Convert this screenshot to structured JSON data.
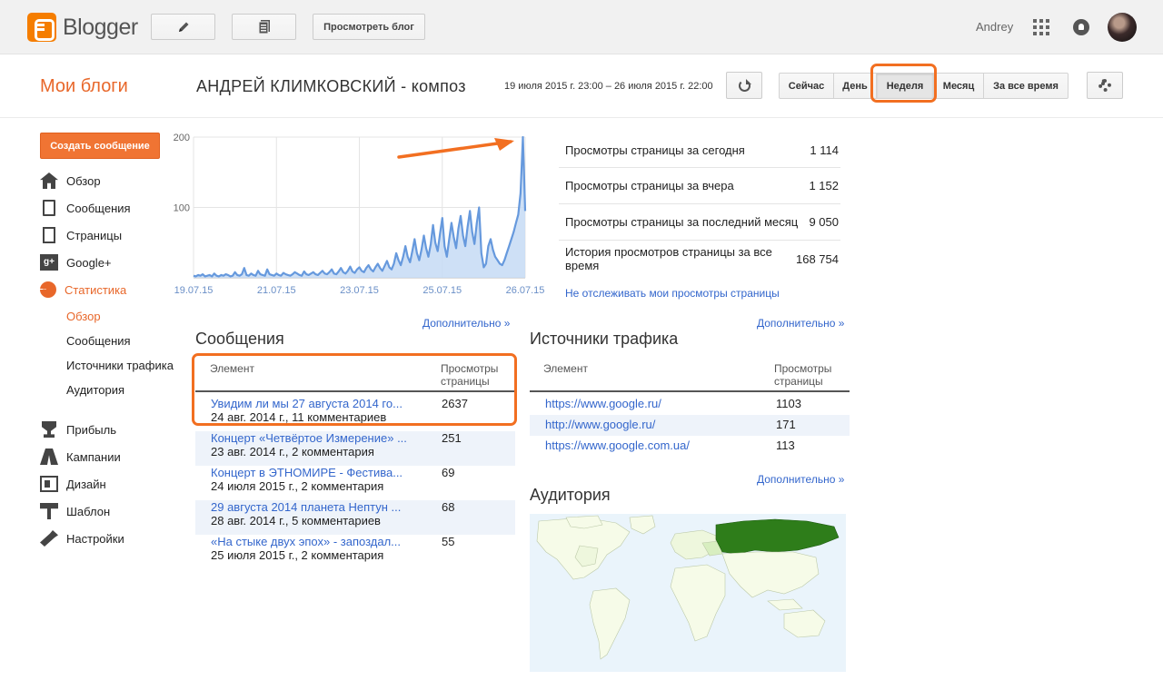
{
  "app": {
    "name": "Blogger"
  },
  "topbar": {
    "view_blog_label": "Просмотреть блог",
    "user_name": "Andrey"
  },
  "header": {
    "my_blogs": "Мои блоги",
    "blog_title": "АНДРЕЙ КЛИМКОВСКИЙ - композ",
    "date_range": "19 июля 2015 г. 23:00 – 26 июля 2015 г. 22:00",
    "periods": [
      "Сейчас",
      "День",
      "Неделя",
      "Месяц",
      "За все время"
    ],
    "active_period": "Неделя",
    "highlight_color": "#f26f21"
  },
  "sidebar": {
    "create_label": "Создать сообщение",
    "items": [
      {
        "label": "Обзор",
        "icon": "home-icon"
      },
      {
        "label": "Сообщения",
        "icon": "posts-icon"
      },
      {
        "label": "Страницы",
        "icon": "pages-icon"
      },
      {
        "label": "Google+",
        "icon": "google-plus-icon"
      },
      {
        "label": "Статистика",
        "icon": "stats-pie-icon"
      },
      {
        "label": "Прибыль",
        "icon": "trophy-icon"
      },
      {
        "label": "Кампании",
        "icon": "campaigns-icon"
      },
      {
        "label": "Дизайн",
        "icon": "layout-icon"
      },
      {
        "label": "Шаблон",
        "icon": "template-brush-icon"
      },
      {
        "label": "Настройки",
        "icon": "wrench-icon"
      }
    ],
    "stats_sub": [
      "Обзор",
      "Сообщения",
      "Источники трафика",
      "Аудитория"
    ],
    "accent": "#e8672a"
  },
  "chart_data": {
    "type": "area",
    "x_tick_labels": [
      "19.07.15",
      "21.07.15",
      "23.07.15",
      "25.07.15",
      "26.07.15"
    ],
    "y_tick_labels": [
      "200",
      "100"
    ],
    "ylim": [
      0,
      200
    ],
    "values": [
      3,
      2,
      4,
      3,
      5,
      2,
      3,
      4,
      2,
      6,
      3,
      2,
      4,
      3,
      5,
      4,
      2,
      3,
      8,
      4,
      3,
      5,
      14,
      4,
      3,
      6,
      4,
      3,
      10,
      5,
      4,
      3,
      12,
      5,
      4,
      3,
      6,
      4,
      3,
      7,
      5,
      4,
      3,
      5,
      8,
      6,
      4,
      3,
      9,
      5,
      4,
      6,
      8,
      5,
      4,
      7,
      10,
      6,
      5,
      8,
      12,
      6,
      5,
      9,
      14,
      8,
      6,
      10,
      16,
      9,
      7,
      12,
      15,
      10,
      8,
      14,
      18,
      12,
      9,
      15,
      20,
      14,
      10,
      17,
      24,
      15,
      12,
      20,
      35,
      25,
      18,
      30,
      45,
      30,
      22,
      38,
      55,
      35,
      25,
      40,
      60,
      42,
      30,
      48,
      75,
      50,
      38,
      62,
      85,
      45,
      30,
      55,
      78,
      58,
      42,
      70,
      88,
      60,
      45,
      72,
      95,
      65,
      48,
      78,
      100,
      35,
      15,
      20,
      45,
      55,
      40,
      30,
      25,
      20,
      18,
      25,
      35,
      45,
      55,
      65,
      78,
      90,
      120,
      200,
      95
    ],
    "grid": true,
    "line_color": "#6699dd",
    "fill_color": "#c5dbf5"
  },
  "stats": [
    {
      "label": "Просмотры страницы за сегодня",
      "value": "1 114"
    },
    {
      "label": "Просмотры страницы за вчера",
      "value": "1 152"
    },
    {
      "label": "Просмотры страницы за последний месяц",
      "value": "9 050"
    },
    {
      "label": "История просмотров страницы за все время",
      "value": "168 754"
    }
  ],
  "no_track_label": "Не отслеживать мои просмотры страницы",
  "more_label": "Дополнительно »",
  "posts": {
    "title": "Сообщения",
    "col_element": "Элемент",
    "col_views": "Просмотры страницы",
    "rows": [
      {
        "title": "Увидим ли мы 27 августа 2014 го...",
        "meta": "24 авг. 2014 г., 11 комментариев",
        "views": "2637"
      },
      {
        "title": "Концерт «Четвёртое Измерение» ...",
        "meta": "23 авг. 2014 г., 2 комментария",
        "views": "251"
      },
      {
        "title": "Концерт в ЭТНОМИРЕ - Фестива...",
        "meta": "24 июля 2015 г., 2 комментария",
        "views": "69"
      },
      {
        "title": "29 августа 2014 планета Нептун ...",
        "meta": "28 авг. 2014 г., 5 комментариев",
        "views": "68"
      },
      {
        "title": "«На стыке двух эпох» - запоздал...",
        "meta": "25 июля 2015 г., 2 комментария",
        "views": "55"
      }
    ]
  },
  "traffic": {
    "title": "Источники трафика",
    "col_element": "Элемент",
    "col_views": "Просмотры страницы",
    "rows": [
      {
        "url": "https://www.google.ru/",
        "views": "1103"
      },
      {
        "url": "http://www.google.ru/",
        "views": "171"
      },
      {
        "url": "https://www.google.com.ua/",
        "views": "113"
      }
    ]
  },
  "audience": {
    "title": "Аудитория",
    "highlight_color": "#2e7d1a"
  }
}
